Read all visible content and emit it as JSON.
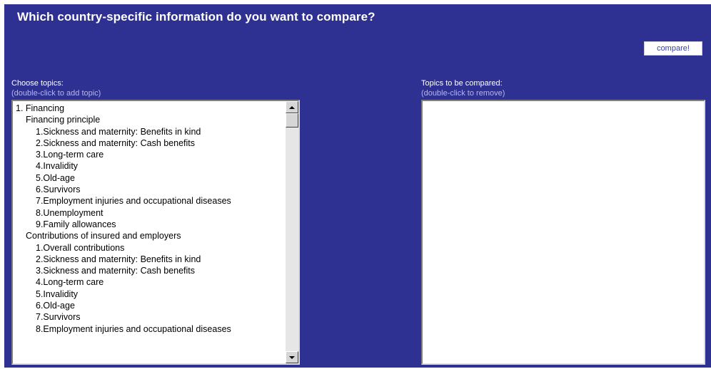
{
  "header": {
    "title": "Which country-specific information do you want to compare?"
  },
  "toolbar": {
    "compare_label": "compare!"
  },
  "left_panel": {
    "label": "Choose topics:",
    "hint": "(double-click to add topic)",
    "items": [
      {
        "text": "1. Financing",
        "level": 0
      },
      {
        "text": "Financing principle",
        "level": 1
      },
      {
        "text": "1.Sickness and maternity: Benefits in kind",
        "level": 2
      },
      {
        "text": "2.Sickness and maternity: Cash benefits",
        "level": 2
      },
      {
        "text": "3.Long-term care",
        "level": 2
      },
      {
        "text": "4.Invalidity",
        "level": 2
      },
      {
        "text": "5.Old-age",
        "level": 2
      },
      {
        "text": "6.Survivors",
        "level": 2
      },
      {
        "text": "7.Employment injuries and occupational diseases",
        "level": 2
      },
      {
        "text": "8.Unemployment",
        "level": 2
      },
      {
        "text": "9.Family allowances",
        "level": 2
      },
      {
        "text": "Contributions of insured and employers",
        "level": 1
      },
      {
        "text": "1.Overall contributions",
        "level": 2
      },
      {
        "text": "2.Sickness and maternity: Benefits in kind",
        "level": 2
      },
      {
        "text": "3.Sickness and maternity: Cash benefits",
        "level": 2
      },
      {
        "text": "4.Long-term care",
        "level": 2
      },
      {
        "text": "5.Invalidity",
        "level": 2
      },
      {
        "text": "6.Old-age",
        "level": 2
      },
      {
        "text": "7.Survivors",
        "level": 2
      },
      {
        "text": "8.Employment injuries and occupational diseases",
        "level": 2
      }
    ]
  },
  "right_panel": {
    "label": "Topics to be compared:",
    "hint": "(double-click to remove)",
    "items": []
  },
  "icons": {
    "scroll_up": "scroll-up-arrow-icon",
    "scroll_down": "scroll-down-arrow-icon"
  },
  "colors": {
    "background": "#2e3192",
    "hint_text": "#b4b7ee",
    "title_text": "#ffffff"
  }
}
